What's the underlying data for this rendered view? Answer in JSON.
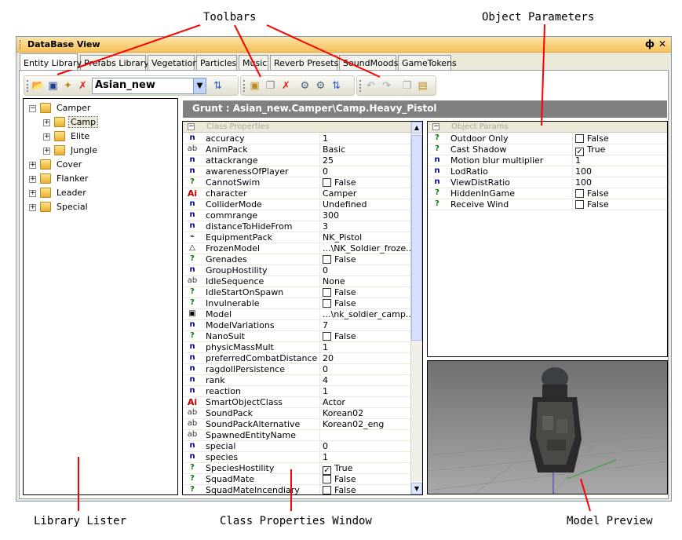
{
  "callouts": {
    "toolbars": "Toolbars",
    "object_parameters": "Object Parameters",
    "library_lister": "Library Lister",
    "class_properties_window": "Class Properties Window",
    "model_preview": "Model Preview"
  },
  "window": {
    "title": "DataBase View",
    "pin_glyph": "ф",
    "close_glyph": "✕"
  },
  "tabs": [
    "Entity Library",
    "Prefabs Library",
    "Vegetation",
    "Particles",
    "Music",
    "Reverb Presets",
    "SoundMoods",
    "GameTokens"
  ],
  "toolbar": {
    "library_combo_value": "Asian_new"
  },
  "tree": [
    {
      "label": "Camper",
      "expander": "−"
    },
    {
      "label": "Camp",
      "expander": "+"
    },
    {
      "label": "Elite",
      "expander": "+"
    },
    {
      "label": "Jungle",
      "expander": "+"
    },
    {
      "label": "Cover",
      "expander": "+"
    },
    {
      "label": "Flanker",
      "expander": "+"
    },
    {
      "label": "Leader",
      "expander": "+"
    },
    {
      "label": "Special",
      "expander": "+"
    }
  ],
  "path_bar": "Grunt  :  Asian_new.Camper\\Camp.Heavy_Pistol",
  "class_properties": {
    "header": "Class Properties",
    "expander": "−",
    "rows": [
      {
        "icon": "n",
        "name": "accuracy",
        "value": "1"
      },
      {
        "icon": "ab",
        "name": "AnimPack",
        "value": "Basic"
      },
      {
        "icon": "n",
        "name": "attackrange",
        "value": "25"
      },
      {
        "icon": "n",
        "name": "awarenessOfPlayer",
        "value": "0"
      },
      {
        "icon": "?",
        "name": "CannotSwim",
        "value": "False",
        "check": ""
      },
      {
        "icon": "Ai",
        "name": "character",
        "value": "Camper"
      },
      {
        "icon": "n",
        "name": "ColliderMode",
        "value": "Undefined"
      },
      {
        "icon": "n",
        "name": "commrange",
        "value": "300"
      },
      {
        "icon": "n",
        "name": "distanceToHideFrom",
        "value": "3"
      },
      {
        "icon": "⌁",
        "name": "EquipmentPack",
        "value": "NK_Pistol"
      },
      {
        "icon": "△",
        "name": "FrozenModel",
        "value": "...\\NK_Soldier_froze..."
      },
      {
        "icon": "?",
        "name": "Grenades",
        "value": "False",
        "check": ""
      },
      {
        "icon": "n",
        "name": "GroupHostility",
        "value": "0"
      },
      {
        "icon": "ab",
        "name": "IdleSequence",
        "value": "None"
      },
      {
        "icon": "?",
        "name": "IdleStartOnSpawn",
        "value": "False",
        "check": ""
      },
      {
        "icon": "?",
        "name": "Invulnerable",
        "value": "False",
        "check": ""
      },
      {
        "icon": "▣",
        "name": "Model",
        "value": "...\\nk_soldier_camp..."
      },
      {
        "icon": "n",
        "name": "ModelVariations",
        "value": "7"
      },
      {
        "icon": "?",
        "name": "NanoSuit",
        "value": "False",
        "check": ""
      },
      {
        "icon": "n",
        "name": "physicMassMult",
        "value": "1"
      },
      {
        "icon": "n",
        "name": "preferredCombatDistance",
        "value": "20"
      },
      {
        "icon": "n",
        "name": "ragdollPersistence",
        "value": "0"
      },
      {
        "icon": "n",
        "name": "rank",
        "value": "4"
      },
      {
        "icon": "n",
        "name": "reaction",
        "value": "1"
      },
      {
        "icon": "Ai",
        "name": "SmartObjectClass",
        "value": "Actor"
      },
      {
        "icon": "ab",
        "name": "SoundPack",
        "value": "Korean02"
      },
      {
        "icon": "ab",
        "name": "SoundPackAlternative",
        "value": "Korean02_eng"
      },
      {
        "icon": "ab",
        "name": "SpawnedEntityName",
        "value": ""
      },
      {
        "icon": "n",
        "name": "special",
        "value": "0"
      },
      {
        "icon": "n",
        "name": "species",
        "value": "1"
      },
      {
        "icon": "?",
        "name": "SpeciesHostility",
        "value": "True",
        "check": "✓"
      },
      {
        "icon": "?",
        "name": "SquadMate",
        "value": "False",
        "check": ""
      },
      {
        "icon": "?",
        "name": "SquadMateIncendiary",
        "value": "False",
        "check": ""
      }
    ]
  },
  "object_params": {
    "header": "Object Params",
    "expander": "−",
    "rows": [
      {
        "icon": "?",
        "name": "Outdoor Only",
        "value": "False",
        "check": ""
      },
      {
        "icon": "?",
        "name": "Cast Shadow",
        "value": "True",
        "check": "✓"
      },
      {
        "icon": "n",
        "name": "Motion blur multiplier",
        "value": "1"
      },
      {
        "icon": "n",
        "name": "LodRatio",
        "value": "100"
      },
      {
        "icon": "n",
        "name": "ViewDistRatio",
        "value": "100"
      },
      {
        "icon": "?",
        "name": "HiddenInGame",
        "value": "False",
        "check": ""
      },
      {
        "icon": "?",
        "name": "Receive Wind",
        "value": "False",
        "check": ""
      }
    ]
  },
  "colors": {
    "title_bar": "#f6c25a",
    "path_bar": "#808080",
    "callout_line": "#ff0000"
  }
}
